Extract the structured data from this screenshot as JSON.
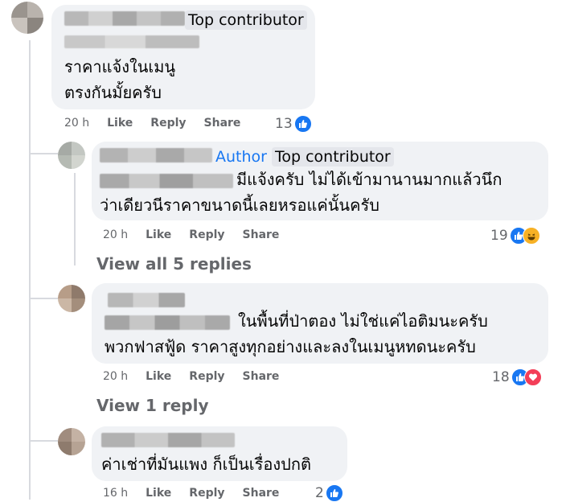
{
  "colors": {
    "bubble": "#f0f2f5",
    "muted": "#65676b",
    "like": "#1877f2",
    "love": "#f33e58",
    "haha": "#f7b125"
  },
  "comments": [
    {
      "badge": "Top contributor",
      "text_lines": [
        "ราคาแจ้งในเมนู",
        "ตรงกันมั้ยครับ"
      ],
      "time": "20 h",
      "like": "Like",
      "reply": "Reply",
      "share": "Share",
      "count": "13",
      "reactions": [
        "like-icon"
      ]
    },
    {
      "author_label": "Author",
      "badge": "Top contributor",
      "text_lines": [
        "มีแจ้งครับ ไม่ได้เข้ามานานมากแล้วนึก",
        "ว่าเดียวนีราคาขนาดนี้เลยหรอแค่นั้นครับ"
      ],
      "time": "20 h",
      "like": "Like",
      "reply": "Reply",
      "share": "Share",
      "count": "19",
      "reactions": [
        "like-icon",
        "haha-icon"
      ]
    },
    {
      "text_lines": [
        "ในพื้นที่ป่าตอง ไม่ใช่แค่ไอติมนะครับ",
        "พวกฟาสฟู้ด ราคาสูงทุกอย่างและลงในเมนูหทดนะครับ"
      ],
      "time": "20 h",
      "like": "Like",
      "reply": "Reply",
      "share": "Share",
      "count": "18",
      "reactions": [
        "like-icon",
        "love-icon"
      ]
    },
    {
      "text_lines": [
        "ค่าเช่าที่มันแพง ก็เป็นเรื่องปกติ"
      ],
      "time": "16 h",
      "like": "Like",
      "reply": "Reply",
      "share": "Share",
      "count": "2",
      "reactions": [
        "like-icon"
      ]
    }
  ],
  "view_all_replies": "View all 5 replies",
  "view_one_reply": "View 1 reply"
}
